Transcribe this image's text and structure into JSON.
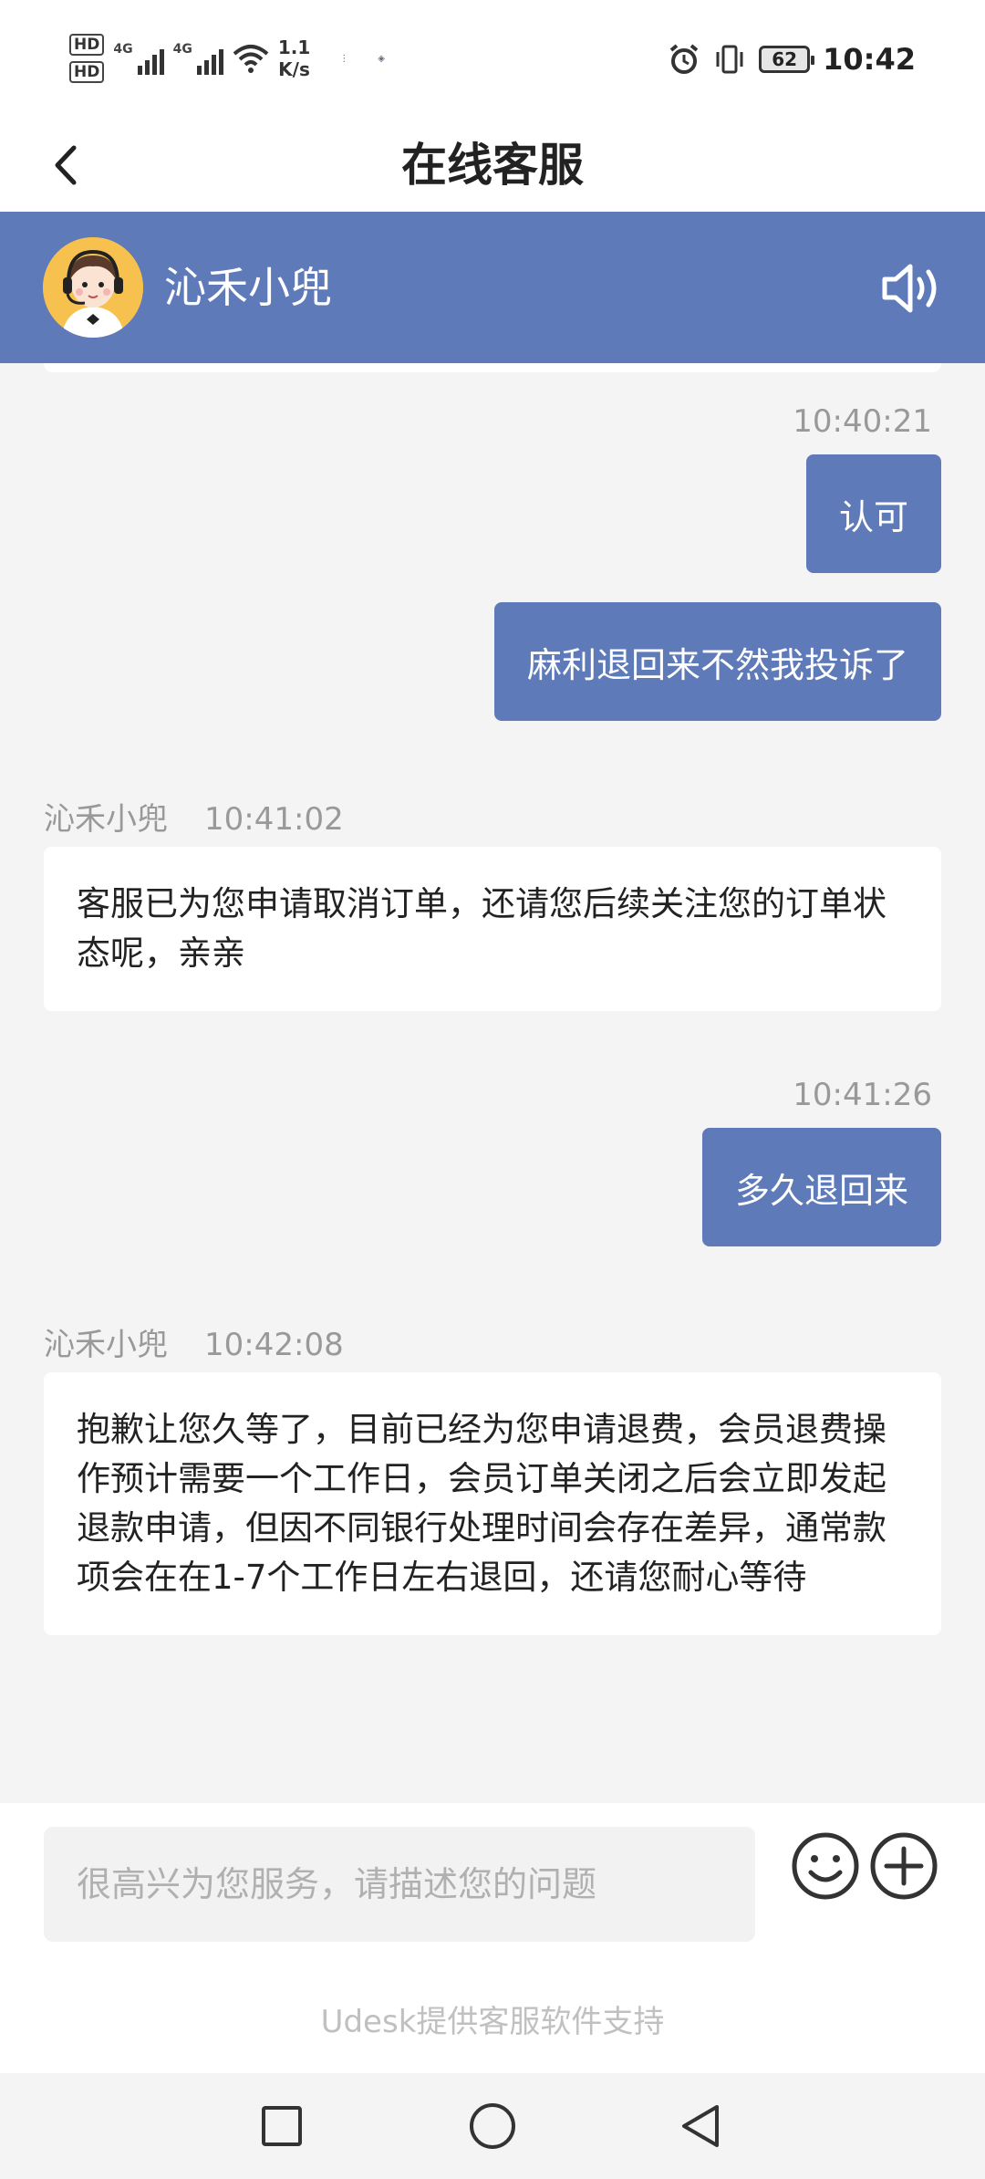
{
  "status_bar": {
    "sim1_label": "HD",
    "sim2_label": "HD",
    "network1": "4G",
    "network2": "4G",
    "speed_value": "1.1",
    "speed_unit": "K/s",
    "battery": "62",
    "time": "10:42"
  },
  "title_bar": {
    "title": "在线客服"
  },
  "agent": {
    "name": "沁禾小兜"
  },
  "messages": [
    {
      "side": "out",
      "time": "10:40:21",
      "text": "认可"
    },
    {
      "side": "out",
      "text": "麻利退回来不然我投诉了"
    },
    {
      "side": "in",
      "sender": "沁禾小兜",
      "time": "10:41:02",
      "text": "客服已为您申请取消订单，还请您后续关注您的订单状态呢，亲亲"
    },
    {
      "side": "out",
      "time": "10:41:26",
      "text": "多久退回来"
    },
    {
      "side": "in",
      "sender": "沁禾小兜",
      "time": "10:42:08",
      "text": "抱歉让您久等了，目前已经为您申请退费，会员退费操作预计需要一个工作日，会员订单关闭之后会立即发起退款申请，但因不同银行处理时间会存在差异，通常款项会在在1-7个工作日左右退回，还请您耐心等待"
    }
  ],
  "input": {
    "placeholder": "很高兴为您服务，请描述您的问题",
    "value": ""
  },
  "footer": {
    "powered_by": "Udesk提供客服软件支持"
  },
  "colors": {
    "accent": "#5e7ab8",
    "background": "#f4f4f4",
    "bubble_in": "#ffffff"
  },
  "icons": {
    "back": "chevron-left-icon",
    "speaker": "speaker-icon",
    "emoji": "emoji-icon",
    "plus": "plus-circle-icon",
    "nav_recent": "square-icon",
    "nav_home": "circle-icon",
    "nav_back": "triangle-back-icon"
  }
}
